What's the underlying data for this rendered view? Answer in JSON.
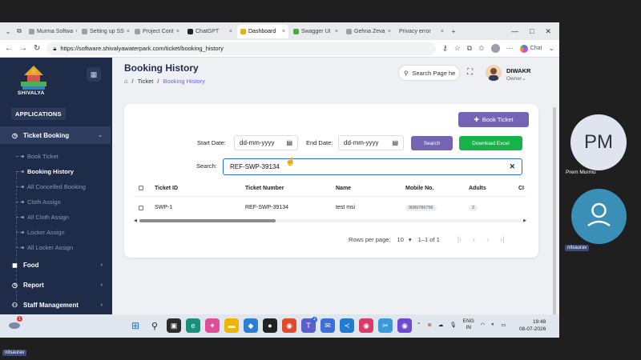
{
  "browser": {
    "tabs": [
      {
        "label": "Murma Softwa",
        "active": false
      },
      {
        "label": "Setting up SS",
        "active": false
      },
      {
        "label": "Project Cont",
        "active": false
      },
      {
        "label": "ChatGPT",
        "active": false
      },
      {
        "label": "Dashboard",
        "active": true
      },
      {
        "label": "Swagger UI",
        "active": false
      },
      {
        "label": "Gehna Zeva",
        "active": false
      },
      {
        "label": "Privacy error",
        "active": false
      }
    ],
    "url": "https://software.shivalyawaterpark.com/ticket/booking_history",
    "chat_label": "Chat"
  },
  "sidebar": {
    "logo_text": "SHIVALYA",
    "section_label": "APPLICATIONS",
    "ticket_booking": "Ticket Booking",
    "submenu": [
      {
        "label": "Book Ticket",
        "active": false
      },
      {
        "label": "Booking History",
        "active": true
      },
      {
        "label": "All Concelled Booking",
        "active": false
      },
      {
        "label": "Cloth Assign",
        "active": false
      },
      {
        "label": "All Cloth Assign",
        "active": false
      },
      {
        "label": "Locker Assign",
        "active": false
      },
      {
        "label": "All Locker Assign",
        "active": false
      }
    ],
    "food": "Food",
    "report": "Report",
    "staff": "Staff Management"
  },
  "header": {
    "title": "Booking History",
    "breadcrumb": [
      "Ticket",
      "Booking History"
    ],
    "search_placeholder": "Search Page he",
    "user_name": "DIWAKR",
    "user_role": "Owner"
  },
  "filters": {
    "start_label": "Start Date:",
    "start_value": "dd-mm-yyyy",
    "end_label": "End Date:",
    "end_value": "dd-mm-yyyy",
    "search_btn": "Search",
    "excel_btn": "Download Excel",
    "search_label": "Search:",
    "search_value": "REF-SWP-39134",
    "book_btn": "Book Ticket"
  },
  "table": {
    "headers": [
      "Ticket ID",
      "Ticket Number",
      "Name",
      "Mobile No.",
      "Adults",
      "Cl"
    ],
    "rows": [
      {
        "id": "SWP-1",
        "number": "REF-SWP-39134",
        "name": "test msi",
        "mobile": "9089786756",
        "adults": "2"
      }
    ],
    "rows_per_page_label": "Rows per page:",
    "rows_per_page": "10",
    "range": "1–1 of 1"
  },
  "participants": {
    "pm_initials": "PM",
    "pm_name": "Prem Murmu",
    "user_tag": "nitsaurav",
    "bottom_tag": "nitsaurav"
  },
  "taskbar": {
    "lang": "ENG",
    "region": "IN",
    "time": "19:48",
    "date": "08-07-2026",
    "weather_badge": "1"
  },
  "colors": {
    "sidebar_bg": "#1e2c4a",
    "accent": "#7464b4",
    "excel_green": "#17b34a"
  }
}
